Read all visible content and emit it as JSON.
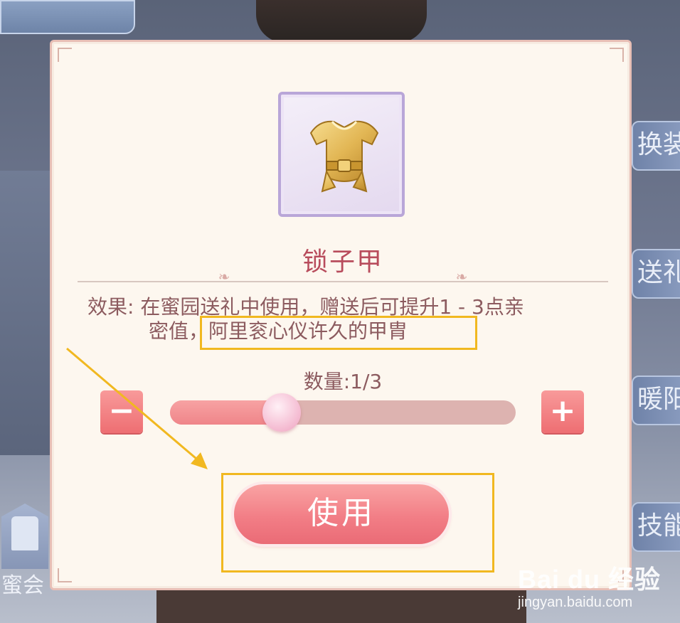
{
  "background": {
    "side_buttons": [
      "换装",
      "送礼",
      "暖阳",
      "技能"
    ],
    "bottom_left_label": "蜜会"
  },
  "dialog": {
    "item_name": "锁子甲",
    "effect_line1": "效果: 在蜜园送礼中使用，赠送后可提升1 - 3点亲",
    "effect_line2": "密值，阿里衮心仪许久的甲胄",
    "quantity_label": "数量:1/3",
    "quantity": {
      "current": 1,
      "max": 3
    },
    "minus_label": "−",
    "plus_label": "+",
    "use_button_label": "使用"
  },
  "colors": {
    "highlight_box": "#f1b820",
    "title_text": "#b84c5c",
    "button_pink": "#f27e86"
  },
  "watermark": {
    "logo": "Bai du 经验",
    "url": "jingyan.baidu.com"
  }
}
